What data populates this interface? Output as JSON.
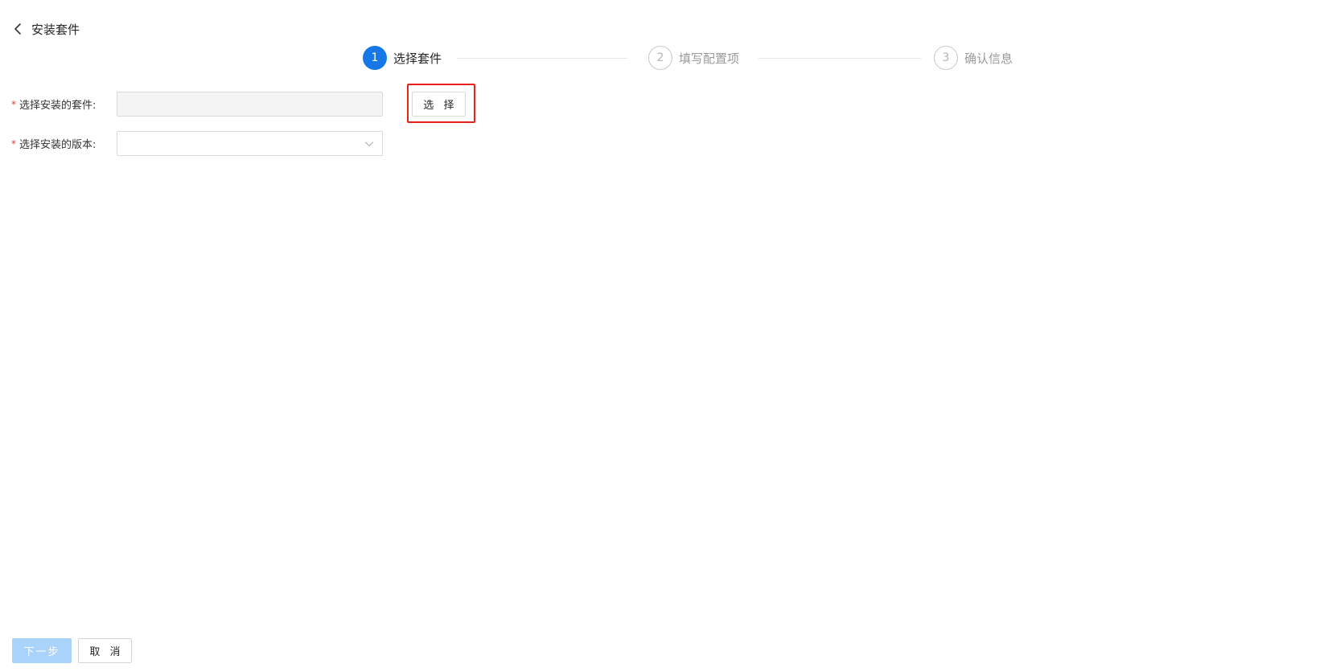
{
  "header": {
    "back_icon": "chevron-left-icon",
    "title": "安装套件"
  },
  "steps": [
    {
      "number": "1",
      "label": "选择套件",
      "status": "active"
    },
    {
      "number": "2",
      "label": "填写配置项",
      "status": "wait"
    },
    {
      "number": "3",
      "label": "确认信息",
      "status": "wait"
    }
  ],
  "form": {
    "package_label": "选择安装的套件:",
    "package_value": "",
    "select_button_label": "选 择",
    "version_label": "选择安装的版本:",
    "version_value": "",
    "required_mark": "*"
  },
  "footer": {
    "next_label": "下一步",
    "cancel_label": "取 消"
  },
  "colors": {
    "primary": "#1677e6",
    "primary_disabled": "#a9d3fa",
    "required": "#e23c39",
    "highlight_frame": "#e8221b"
  }
}
